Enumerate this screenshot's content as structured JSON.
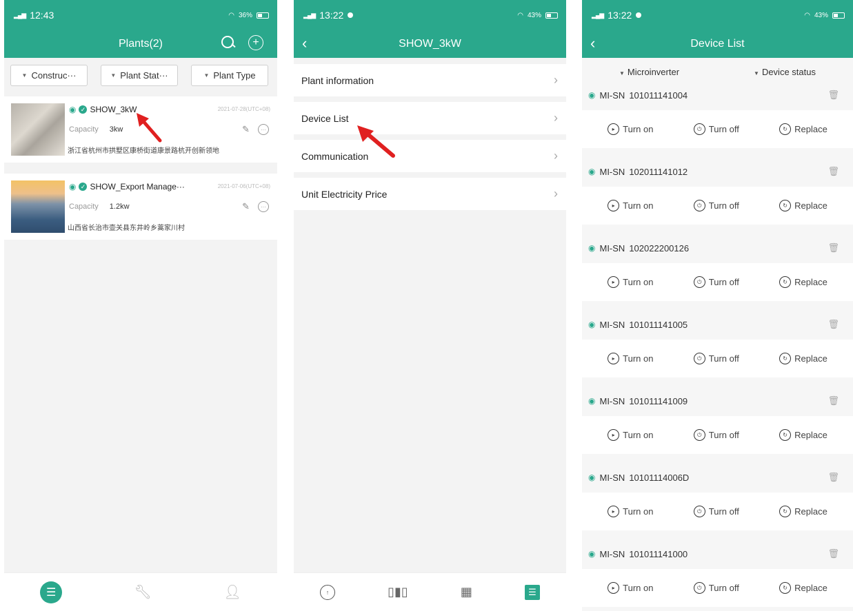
{
  "phone1": {
    "status": {
      "time": "12:43",
      "battery": "36%"
    },
    "nav": {
      "title": "Plants(2)"
    },
    "filters": [
      "Construc···",
      "Plant Stat···",
      "Plant Type"
    ],
    "plants": [
      {
        "name": "SHOW_3kW",
        "date": "2021-07-28(UTC+08)",
        "capacity_label": "Capacity",
        "capacity": "3kw",
        "address": "浙江省杭州市拱墅区康桥街道康景路杭开创新领地"
      },
      {
        "name": "SHOW_Export Manage···",
        "date": "2021-07-06(UTC+08)",
        "capacity_label": "Capacity",
        "capacity": "1.2kw",
        "address": "山西省长治市壶关县东井岭乡蒿家川村"
      }
    ]
  },
  "phone2": {
    "status": {
      "time": "13:22",
      "battery": "43%"
    },
    "nav": {
      "title": "SHOW_3kW"
    },
    "menu": [
      "Plant information",
      "Device List",
      "Communication",
      "Unit Electricity Price"
    ]
  },
  "phone3": {
    "status": {
      "time": "13:22",
      "battery": "43%"
    },
    "nav": {
      "title": "Device List"
    },
    "filters": [
      "Microinverter",
      "Device status"
    ],
    "sn_label": "MI-SN",
    "actions": {
      "on": "Turn on",
      "off": "Turn off",
      "replace": "Replace"
    },
    "devices": [
      "101011141004",
      "102011141012",
      "102022200126",
      "101011141005",
      "101011141009",
      "10101114006D",
      "101011141000"
    ]
  },
  "colors": {
    "brand": "#2aa88c",
    "arrow": "#e02020"
  },
  "icons": [
    "search-icon",
    "add-icon",
    "back-icon",
    "wifi-icon",
    "check-icon",
    "edit-icon",
    "more-icon",
    "chevron-right-icon",
    "trash-icon",
    "power-icon",
    "replace-icon",
    "play-icon"
  ]
}
